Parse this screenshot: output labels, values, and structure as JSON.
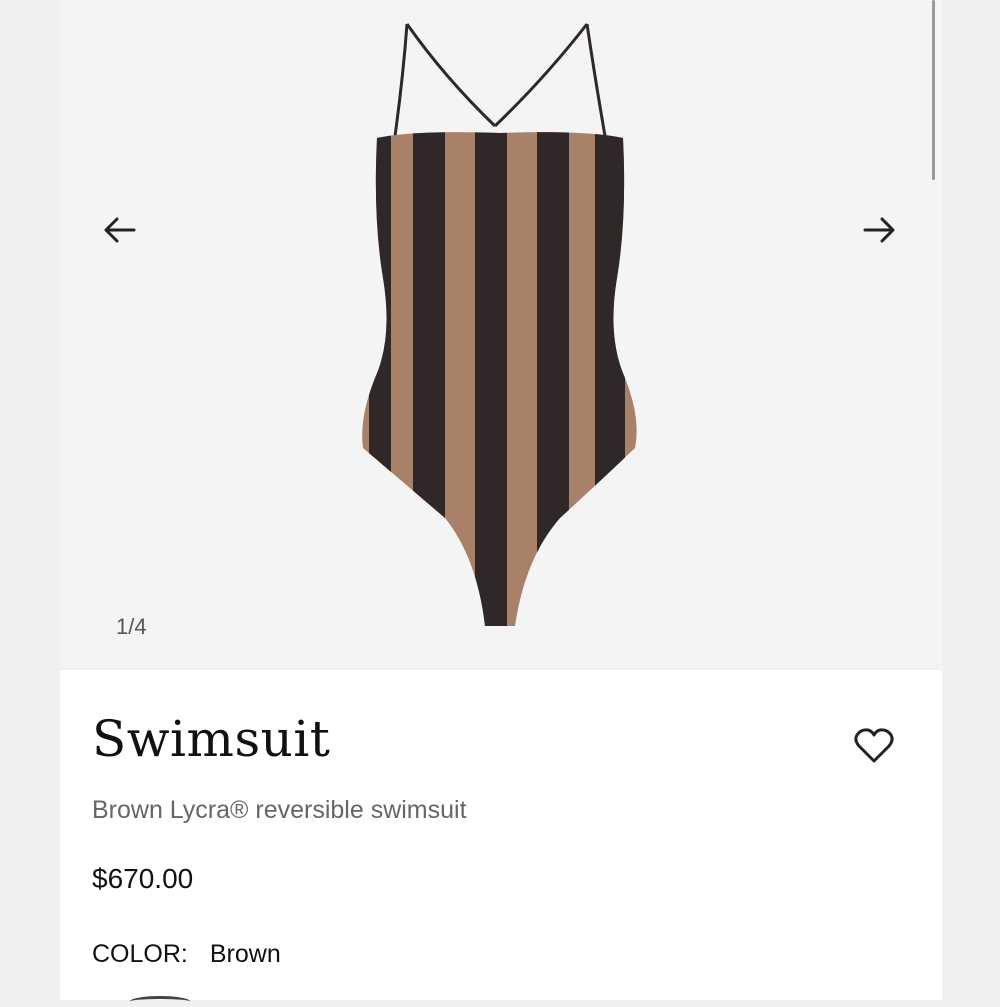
{
  "gallery": {
    "counter": "1/4",
    "prev_icon": "arrow-left-icon",
    "next_icon": "arrow-right-icon",
    "image": "striped-swimsuit",
    "colors": {
      "background": "#f4f4f4",
      "stripe_dark": "#2f2728",
      "stripe_light": "#a98168"
    }
  },
  "product": {
    "title": "Swimsuit",
    "description": "Brown Lycra® reversible swimsuit",
    "price": "$670.00",
    "color_label": "COLOR:",
    "color_value": "Brown",
    "wishlist_icon": "heart-icon"
  }
}
